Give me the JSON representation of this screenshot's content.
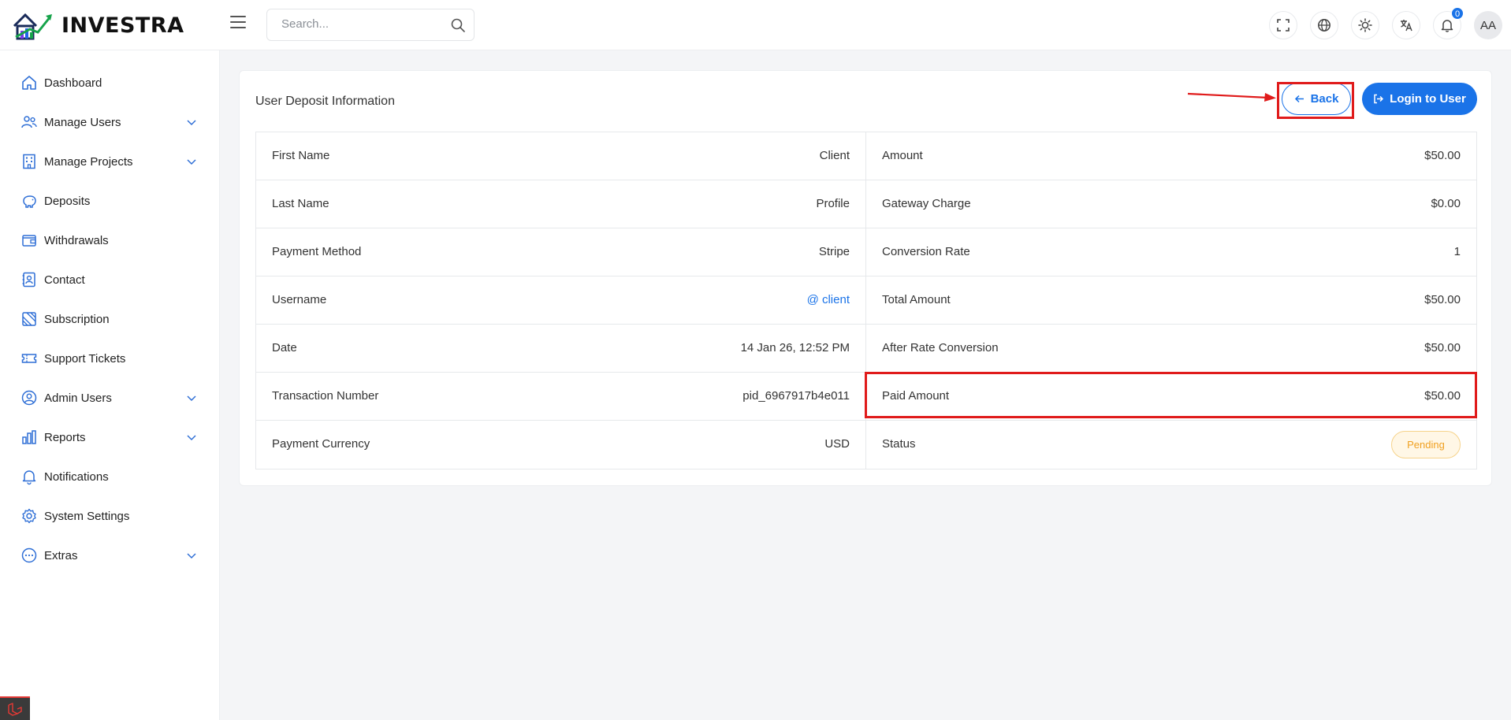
{
  "brand": {
    "name": "INVESTRA"
  },
  "header": {
    "search_placeholder": "Search...",
    "notification_count": "0",
    "avatar_initials": "AA"
  },
  "sidebar": {
    "items": [
      {
        "label": "Dashboard",
        "icon": "home-icon",
        "expandable": false
      },
      {
        "label": "Manage Users",
        "icon": "users-icon",
        "expandable": true
      },
      {
        "label": "Manage Projects",
        "icon": "building-icon",
        "expandable": true
      },
      {
        "label": "Deposits",
        "icon": "piggy-bank-icon",
        "expandable": false
      },
      {
        "label": "Withdrawals",
        "icon": "wallet-icon",
        "expandable": false
      },
      {
        "label": "Contact",
        "icon": "contact-book-icon",
        "expandable": false
      },
      {
        "label": "Subscription",
        "icon": "subscription-icon",
        "expandable": false
      },
      {
        "label": "Support Tickets",
        "icon": "ticket-icon",
        "expandable": false
      },
      {
        "label": "Admin Users",
        "icon": "admin-user-icon",
        "expandable": true
      },
      {
        "label": "Reports",
        "icon": "bar-chart-icon",
        "expandable": true
      },
      {
        "label": "Notifications",
        "icon": "bell-icon",
        "expandable": false
      },
      {
        "label": "System Settings",
        "icon": "gear-icon",
        "expandable": false
      },
      {
        "label": "Extras",
        "icon": "more-circle-icon",
        "expandable": true
      }
    ]
  },
  "card": {
    "title": "User Deposit Information",
    "back_label": "Back",
    "login_label": "Login to User"
  },
  "details": {
    "left": [
      {
        "key": "First Name",
        "value": "Client"
      },
      {
        "key": "Last Name",
        "value": "Profile"
      },
      {
        "key": "Payment Method",
        "value": "Stripe"
      },
      {
        "key": "Username",
        "value": "@ client"
      },
      {
        "key": "Date",
        "value": "14 Jan 26, 12:52 PM"
      },
      {
        "key": "Transaction Number",
        "value": "pid_6967917b4e011"
      },
      {
        "key": "Payment Currency",
        "value": "USD"
      }
    ],
    "right": [
      {
        "key": "Amount",
        "value": "$50.00"
      },
      {
        "key": "Gateway Charge",
        "value": "$0.00"
      },
      {
        "key": "Conversion Rate",
        "value": "1"
      },
      {
        "key": "Total Amount",
        "value": "$50.00"
      },
      {
        "key": "After Rate Conversion",
        "value": "$50.00"
      },
      {
        "key": "Paid Amount",
        "value": "$50.00"
      },
      {
        "key": "Status",
        "value": "Pending"
      }
    ]
  },
  "colors": {
    "accent": "#1a73e8",
    "annotation_red": "#e01b1b",
    "pending": "#f0a020"
  }
}
